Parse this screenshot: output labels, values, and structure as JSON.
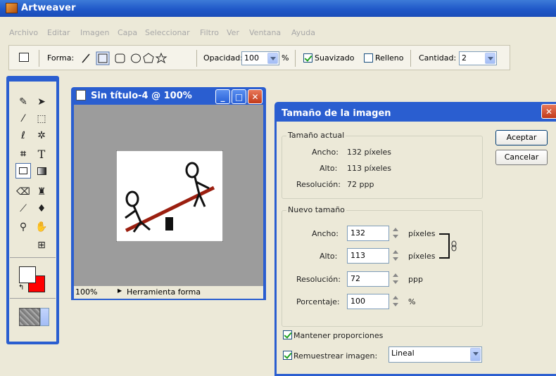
{
  "app": {
    "title": "Artweaver"
  },
  "menu": [
    "Archivo",
    "Editar",
    "Imagen",
    "Capa",
    "Seleccionar",
    "Filtro",
    "Ver",
    "Ventana",
    "Ayuda"
  ],
  "toolbar": {
    "shape_label": "Forma:",
    "opacity_label": "Opacidad:",
    "opacity_value": "100",
    "percent": "%",
    "smooth_label": "Suavizado",
    "smooth_checked": true,
    "fill_label": "Relleno",
    "fill_checked": false,
    "amount_label": "Cantidad:",
    "amount_value": "2"
  },
  "document": {
    "title": "Sin título-4 @ 100%",
    "zoom": "100%",
    "status_tool": "Herramienta forma",
    "colors": {
      "foreground": "#ffffff",
      "background": "#ff0000"
    }
  },
  "dialog": {
    "title": "Tamaño de la imagen",
    "current_group": "Tamaño actual",
    "current": {
      "width_label": "Ancho:",
      "width_value": "132 píxeles",
      "height_label": "Alto:",
      "height_value": "113 píxeles",
      "res_label": "Resolución:",
      "res_value": "72 ppp"
    },
    "new_group": "Nuevo tamaño",
    "new": {
      "width_label": "Ancho:",
      "width_value": "132",
      "width_unit": "píxeles",
      "height_label": "Alto:",
      "height_value": "113",
      "height_unit": "píxeles",
      "res_label": "Resolución:",
      "res_value": "72",
      "res_unit": "ppp",
      "pct_label": "Porcentaje:",
      "pct_value": "100",
      "pct_unit": "%"
    },
    "keep_proportions_label": "Mantener proporciones",
    "keep_proportions": true,
    "resample_label": "Remuestrear imagen:",
    "resample": true,
    "resample_method": "Lineal",
    "ok_label": "Aceptar",
    "cancel_label": "Cancelar"
  }
}
